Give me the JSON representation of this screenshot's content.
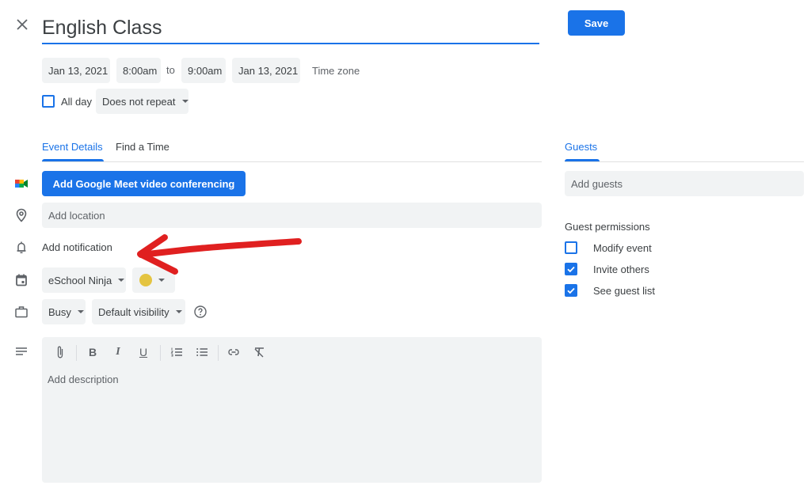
{
  "header": {
    "close_icon": "close-icon",
    "title_value": "English Class",
    "save_label": "Save"
  },
  "datetime": {
    "start_date": "Jan 13, 2021",
    "start_time": "8:00am",
    "to_label": "to",
    "end_time": "9:00am",
    "end_date": "Jan 13, 2021",
    "timezone_label": "Time zone",
    "all_day_label": "All day",
    "all_day_checked": false,
    "repeat_value": "Does not repeat"
  },
  "tabs": {
    "items": [
      {
        "label": "Event Details",
        "active": true
      },
      {
        "label": "Find a Time",
        "active": false
      }
    ]
  },
  "details": {
    "meet_icon": "google-meet-icon",
    "meet_button_label": "Add Google Meet video conferencing",
    "location_icon": "location-pin-icon",
    "location_placeholder": "Add location",
    "notification_icon": "bell-icon",
    "notification_label": "Add notification",
    "calendar_icon": "calendar-icon",
    "calendar_value": "eSchool Ninja",
    "event_color": "#e4c441",
    "status_icon": "briefcase-icon",
    "availability_value": "Busy",
    "visibility_value": "Default visibility",
    "help_icon": "help-circle-icon",
    "description_icon": "notes-icon",
    "description_placeholder": "Add description"
  },
  "editor_toolbar": {
    "items": [
      {
        "name": "attachment-icon",
        "glyph": "attach"
      },
      {
        "name": "bold-icon",
        "glyph": "B"
      },
      {
        "name": "italic-icon",
        "glyph": "I"
      },
      {
        "name": "underline-icon",
        "glyph": "U"
      },
      {
        "name": "numbered-list-icon",
        "glyph": "ol"
      },
      {
        "name": "bulleted-list-icon",
        "glyph": "ul"
      },
      {
        "name": "link-icon",
        "glyph": "link"
      },
      {
        "name": "remove-formatting-icon",
        "glyph": "clear"
      }
    ]
  },
  "guests": {
    "tab_label": "Guests",
    "add_guests_placeholder": "Add guests",
    "permissions_title": "Guest permissions",
    "permissions": [
      {
        "label": "Modify event",
        "checked": false
      },
      {
        "label": "Invite others",
        "checked": true
      },
      {
        "label": "See guest list",
        "checked": true
      }
    ]
  },
  "annotation": {
    "arrow_color": "#e02020",
    "arrow_target": "Add notification"
  },
  "colors": {
    "accent": "#1a73e8",
    "field_bg": "#f1f3f4",
    "text": "#3c4043"
  }
}
